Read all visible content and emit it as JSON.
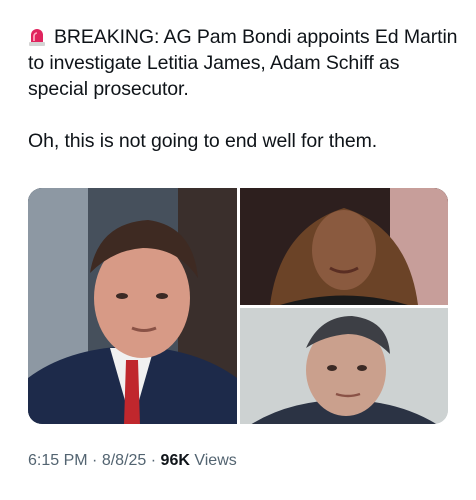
{
  "tweet": {
    "headline_emoji": "siren-icon",
    "headline": "BREAKING: AG Pam Bondi appoints Ed Martin to investigate Letitia James, Adam Schiff as special prosecutor.",
    "comment": "Oh, this is not going to end well for them."
  },
  "media": {
    "photos": [
      {
        "name": "photo-man-red-tie"
      },
      {
        "name": "photo-woman-portrait"
      },
      {
        "name": "photo-man-gray-background"
      }
    ]
  },
  "meta": {
    "time": "6:15 PM",
    "separator": "·",
    "date": "8/8/25",
    "views_count": "96K",
    "views_label": "Views"
  },
  "colors": {
    "text": "#0f1419",
    "secondary": "#536471",
    "siren": "#e0245e"
  }
}
